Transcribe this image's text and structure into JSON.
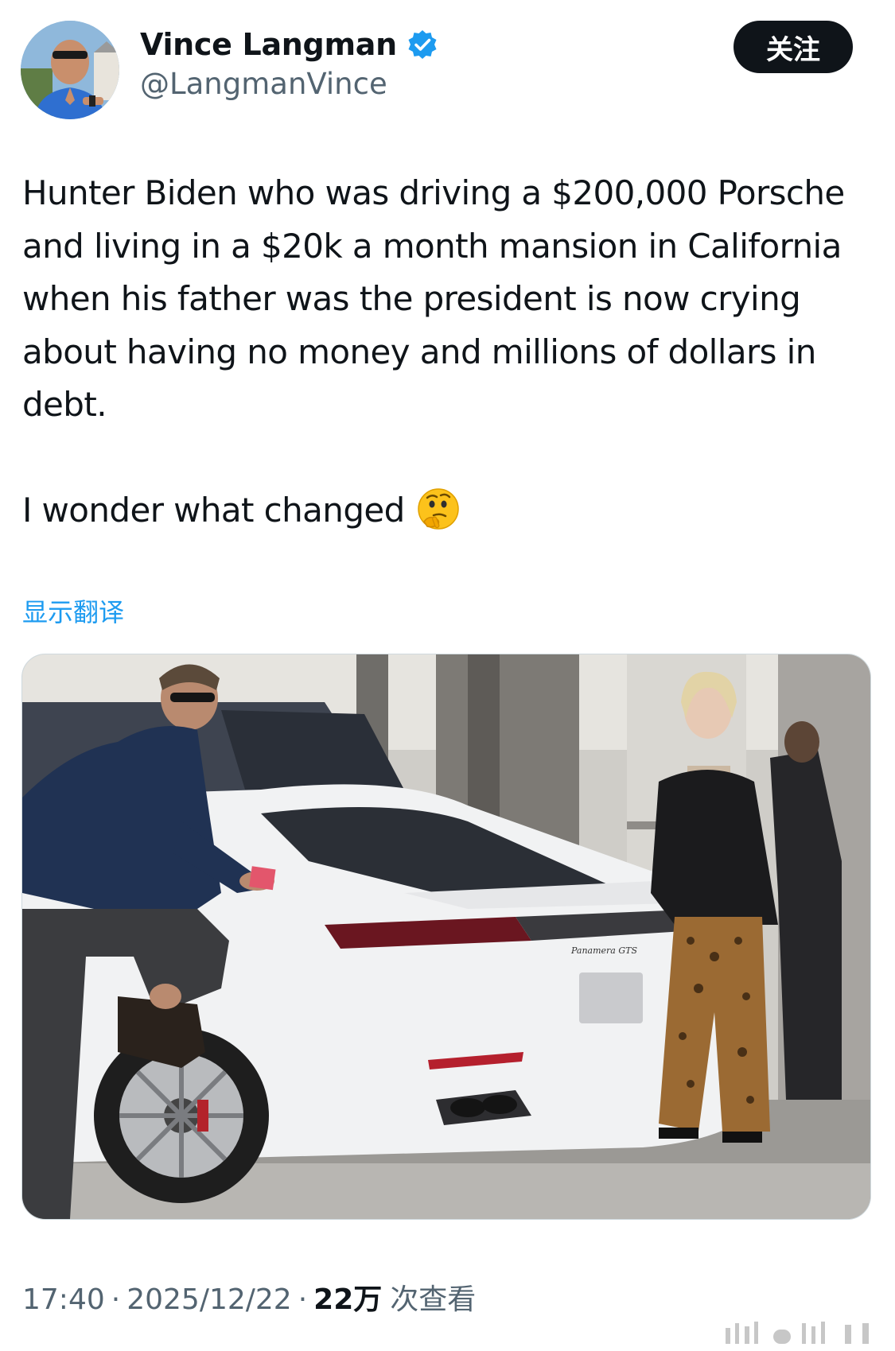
{
  "header": {
    "display_name": "Vince Langman",
    "handle": "@LangmanVince",
    "follow_label": "关注",
    "verified_icon": "verified-badge-icon",
    "accent_color": "#1d9bf0"
  },
  "tweet": {
    "paragraph_1": "Hunter Biden who was driving a $200,000 Porsche and living in a $20k a month mansion in California when his father was the president is now crying about having no money and millions of dollars in debt.",
    "paragraph_2": "I wonder what changed",
    "emoji": "thinking-face",
    "translate_label": "显示翻译"
  },
  "media": {
    "badge_text": "Panamera GTS"
  },
  "meta": {
    "time": "17:40",
    "date": "2025/12/22",
    "separator": "·",
    "views_count": "22万",
    "views_label": "次查看"
  }
}
